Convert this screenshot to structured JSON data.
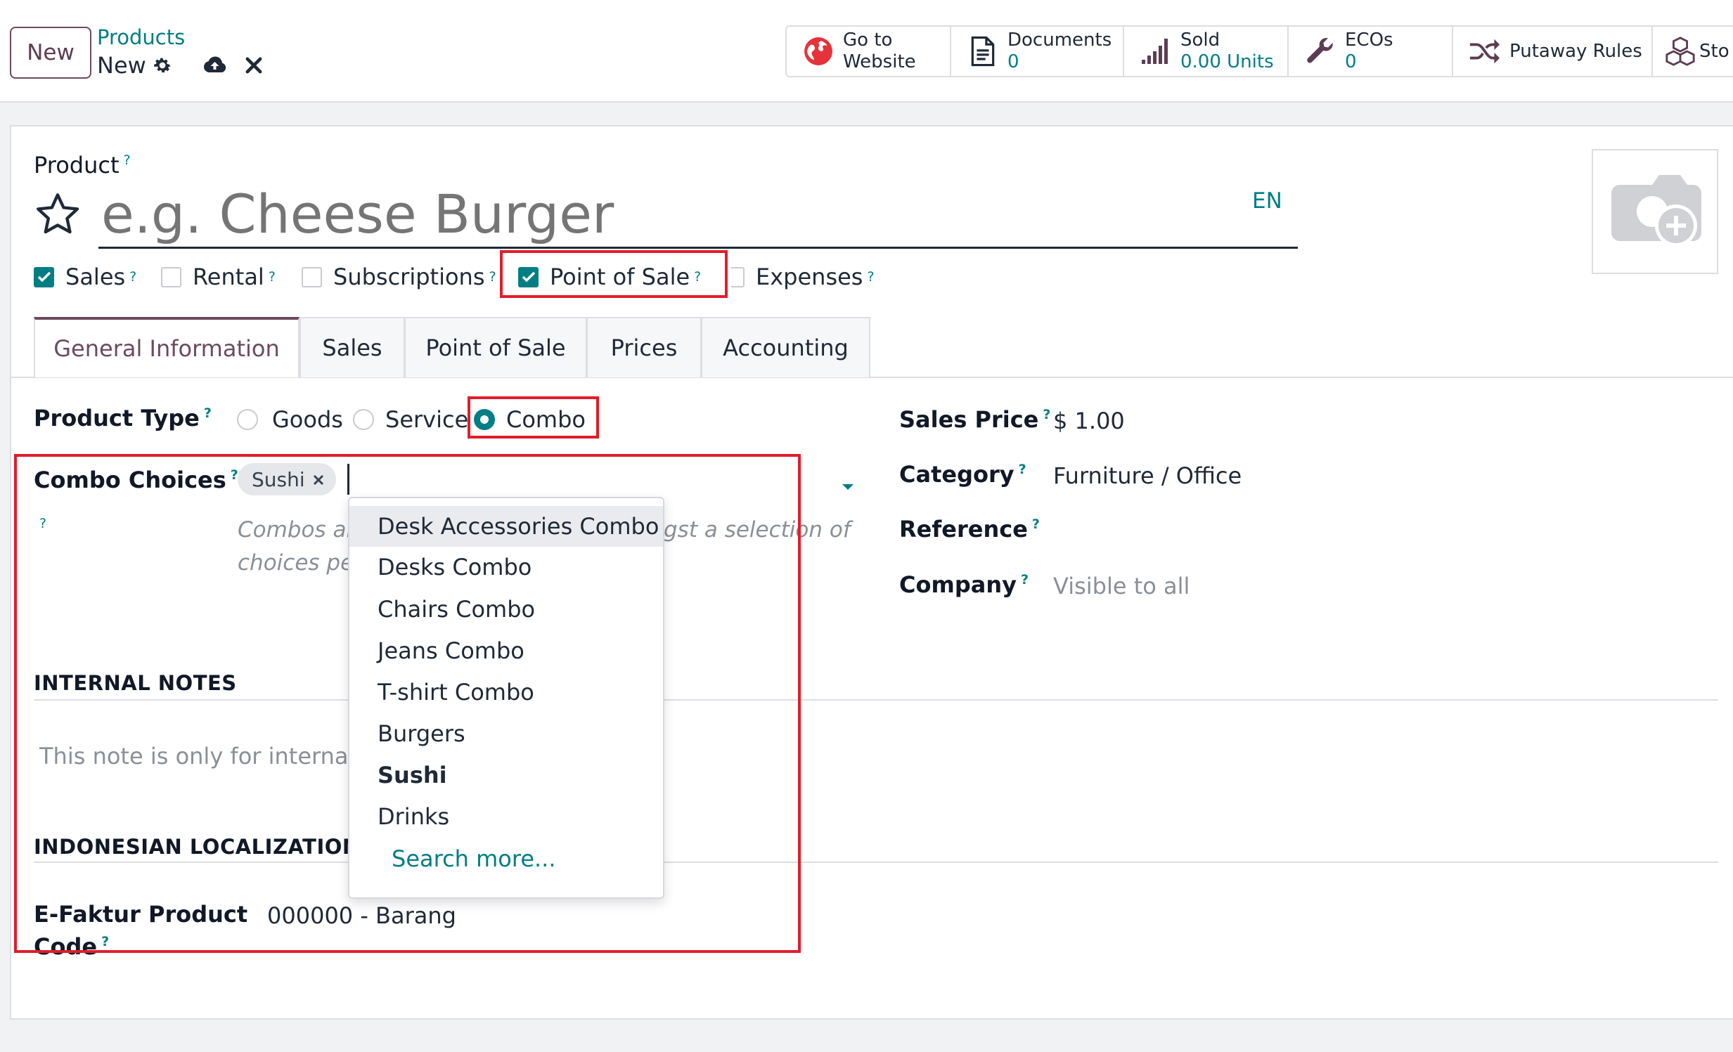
{
  "control_panel": {
    "new_label": "New",
    "breadcrumb_parent": "Products",
    "breadcrumb_current": "New",
    "smart_buttons": [
      {
        "line1": "Go to",
        "line2": "Website",
        "icon": "globe-icon"
      },
      {
        "line1": "Documents",
        "line2": "0",
        "icon": "document-icon"
      },
      {
        "line1": "Sold",
        "line2": "0.00 Units",
        "icon": "bar-chart-icon"
      },
      {
        "line1": "ECOs",
        "line2": "0",
        "icon": "wrench-icon"
      },
      {
        "line1": "Putaway Rules",
        "line2": "",
        "icon": "shuffle-icon"
      },
      {
        "line1": "Sto",
        "line2": "",
        "icon": "cubes-icon"
      }
    ]
  },
  "product": {
    "label": "Product",
    "help": "?",
    "name_placeholder": "e.g. Cheese Burger",
    "lang": "EN",
    "flags": [
      {
        "label": "Sales",
        "checked": true
      },
      {
        "label": "Rental",
        "checked": false
      },
      {
        "label": "Subscriptions",
        "checked": false
      },
      {
        "label": "Point of Sale",
        "checked": true
      },
      {
        "label": "Expenses",
        "checked": false
      }
    ]
  },
  "tabs": [
    "General Information",
    "Sales",
    "Point of Sale",
    "Prices",
    "Accounting"
  ],
  "active_tab": "General Information",
  "general": {
    "product_type_label": "Product Type",
    "product_type_options": [
      "Goods",
      "Service",
      "Combo"
    ],
    "product_type_selected": "Combo",
    "combo_choices_label": "Combo Choices",
    "combo_tag": "Sushi",
    "combo_help_text_line1": "Combos all",
    "combo_help_text_line1_tail": "gst a selection of",
    "combo_help_text_line2": "choices per",
    "internal_notes_title": "INTERNAL NOTES",
    "internal_notes_placeholder": "This note is only for internal p",
    "localization_title": "INDONESIAN LOCALIZATION",
    "efaktur_label_line1": "E-Faktur Product",
    "efaktur_label_line2": "Code",
    "efaktur_value": "000000 - Barang"
  },
  "right_fields": {
    "sales_price_label": "Sales Price",
    "sales_price_value": "$ 1.00",
    "category_label": "Category",
    "category_value": "Furniture / Office",
    "reference_label": "Reference",
    "reference_value": "",
    "company_label": "Company",
    "company_placeholder": "Visible to all"
  },
  "combo_dropdown": {
    "items": [
      "Desk Accessories Combo",
      "Desks Combo",
      "Chairs Combo",
      "Jeans Combo",
      "T-shirt Combo",
      "Burgers",
      "Sushi",
      "Drinks"
    ],
    "highlighted": "Desk Accessories Combo",
    "bold_item": "Sushi",
    "search_more": "Search more..."
  },
  "colors": {
    "accent": "#017e84",
    "brand": "#6b4a60",
    "annotation": "#e11d2a"
  }
}
